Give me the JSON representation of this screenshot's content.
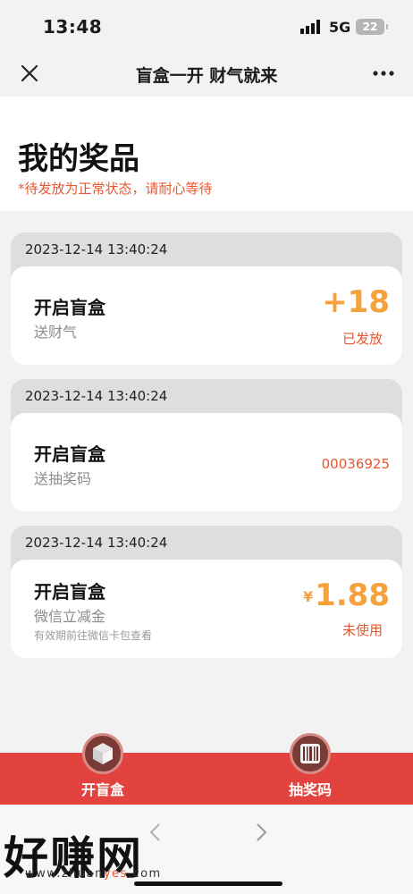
{
  "status_bar": {
    "time": "13:48",
    "network": "5G",
    "battery": "22"
  },
  "nav": {
    "title": "盲盒一开 财气就来"
  },
  "header": {
    "title": "我的奖品",
    "notice": "*待发放为正常状态，请耐心等待"
  },
  "prizes": [
    {
      "time": "2023-12-14 13:40:24",
      "name": "开启盲盒",
      "desc": "送财气",
      "value": "+18",
      "status": "已发放"
    },
    {
      "time": "2023-12-14 13:40:24",
      "name": "开启盲盒",
      "desc": "送抽奖码",
      "code": "00036925"
    },
    {
      "time": "2023-12-14 13:40:24",
      "name": "开启盲盒",
      "desc": "微信立减金",
      "note": "有效期前往微信卡包查看",
      "currency": "¥",
      "value": "1.88",
      "status": "未使用"
    }
  ],
  "tabs": [
    {
      "label": "开盲盒",
      "icon": "box-icon"
    },
    {
      "label": "抽奖码",
      "icon": "barcode-icon"
    }
  ],
  "watermark": {
    "text": "好赚网",
    "url_prefix": "www.zhuan",
    "url_highlight": "yes",
    "url_suffix": ".com"
  },
  "colors": {
    "accent_red": "#e2433f",
    "orange": "#f5a23c",
    "notice": "#e8572f"
  }
}
